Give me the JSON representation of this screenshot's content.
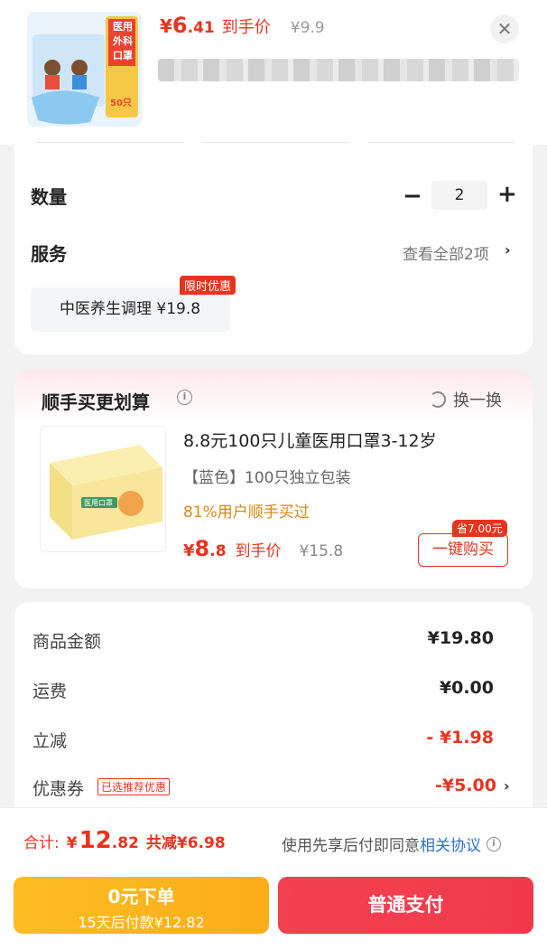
{
  "product": {
    "image_text": [
      "医用",
      "外科",
      "口罩",
      "50只"
    ],
    "price_yen": "¥",
    "price_int": "6",
    "price_dec": ".41",
    "price_tag": "到手价",
    "original_price": "¥9.9"
  },
  "quantity": {
    "label": "数量",
    "value": "2"
  },
  "service": {
    "label": "服务",
    "view_all": "查看全部2项",
    "chip": "中医养生调理  ¥19.8",
    "badge": "限时优惠"
  },
  "bundle": {
    "title": "顺手买更划算",
    "swap_label": "换一换",
    "image_text": "医用口罩",
    "name": "8.8元100只儿童医用口罩3-12岁",
    "spec": "【蓝色】100只独立包装",
    "stat": "81%用户顺手买过",
    "price_yen": "¥",
    "price_int": "8",
    "price_dec": ".8",
    "price_tag": "到手价",
    "original_price": "¥15.8",
    "save_badge": "省7.00元",
    "buy_label": "一键购买"
  },
  "summary": {
    "rows": [
      {
        "label": "商品金额",
        "value": "¥19.80"
      },
      {
        "label": "运费",
        "value": "¥0.00"
      },
      {
        "label": "立减",
        "value": "- ¥1.98"
      },
      {
        "label": "优惠券",
        "value": "-¥5.00"
      }
    ],
    "coupon_tag": "已选推荐优惠"
  },
  "footer": {
    "total_label": "合计:",
    "total_yen": "¥",
    "total_int": "12",
    "total_dec": ".82",
    "saved": "共减¥6.98",
    "agree_text": "使用先享后付即同意",
    "agree_link": "相关协议",
    "later_title": "0元下单",
    "later_sub": "15天后付款¥12.82",
    "pay_label": "普通支付"
  },
  "colors": {
    "accent": "#e8341f",
    "pay": "#f03a4c",
    "later": "#fbb21e",
    "link": "#2a6fd6"
  }
}
